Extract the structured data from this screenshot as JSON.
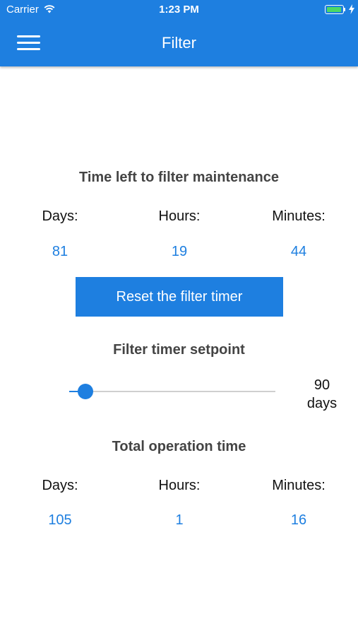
{
  "status_bar": {
    "carrier": "Carrier",
    "time": "1:23 PM"
  },
  "app_bar": {
    "title": "Filter",
    "menu_icon": "hamburger-menu-icon",
    "color": "#1E7FE0"
  },
  "maintenance": {
    "title": "Time left to filter maintenance",
    "days_label": "Days:",
    "hours_label": "Hours:",
    "minutes_label": "Minutes:",
    "days": "81",
    "hours": "19",
    "minutes": "44"
  },
  "reset_button": {
    "label": "Reset the filter timer"
  },
  "setpoint": {
    "title": "Filter timer setpoint",
    "value": "90",
    "unit": "days",
    "slider_fraction": 0.078
  },
  "operation": {
    "title": "Total operation time",
    "days_label": "Days:",
    "hours_label": "Hours:",
    "minutes_label": "Minutes:",
    "days": "105",
    "hours": "1",
    "minutes": "16"
  }
}
